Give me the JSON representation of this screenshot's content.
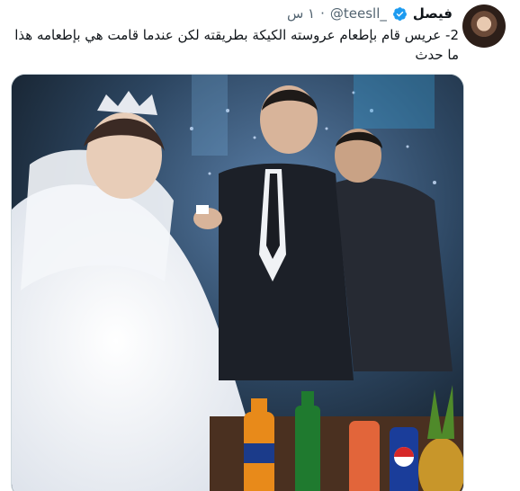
{
  "tweet": {
    "author_name": "فيصل",
    "handle": "@teesll_",
    "time": "١ س",
    "text": "2- عريس قام بإطعام عروسته الكيكة بطريقته لكن عندما قامت هي بإطعامه هذا ما حدث",
    "verified": true
  },
  "icons": {
    "verified": "verified-badge-icon",
    "avatar": "avatar"
  },
  "colors": {
    "verified": "#1d9bf0",
    "text": "#0f1419",
    "secondary": "#536471",
    "border": "#cfd9de"
  },
  "media": {
    "type": "video-thumbnail",
    "description_visible": false
  }
}
